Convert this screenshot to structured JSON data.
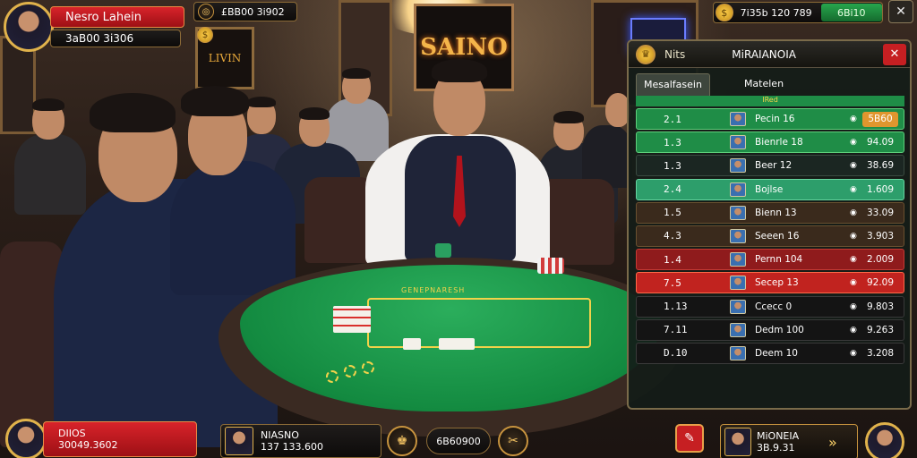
{
  "top_left": {
    "player_name": "Nesro Lahein",
    "player_balance": "3aB00 3i306"
  },
  "top_center": {
    "balance": "£BB00 3i902"
  },
  "top_right": {
    "balance": "7i35b 120 789",
    "amount": "6Bi10",
    "close_glyph": "✕"
  },
  "wall": {
    "sign_text": "SAINO",
    "sign2_text": "LIVIN"
  },
  "panel": {
    "header_left": "Nits",
    "header_title": "MiRAIANOIA",
    "close_glyph": "✕",
    "tabs": [
      {
        "label": "Mesalfasein"
      },
      {
        "label": "Matelen"
      }
    ],
    "subheader": "IRed",
    "rows": [
      {
        "pos": "2.1",
        "name": "Pecin 16",
        "amount": "5B60",
        "theme": "green",
        "amt_bg": "#e0962e"
      },
      {
        "pos": "1.3",
        "name": "Bienrle 18",
        "amount": "94.09",
        "theme": "green",
        "amt_bg": ""
      },
      {
        "pos": "1.3",
        "name": "Beer 12",
        "amount": "38.69",
        "theme": "dark",
        "amt_bg": ""
      },
      {
        "pos": "2.4",
        "name": "Bojlse",
        "amount": "1.609",
        "theme": "teal",
        "amt_bg": ""
      },
      {
        "pos": "1.5",
        "name": "Bienn 13",
        "amount": "33.09",
        "theme": "brown",
        "amt_bg": ""
      },
      {
        "pos": "4.3",
        "name": "Seeen 16",
        "amount": "3.903",
        "theme": "brown",
        "amt_bg": ""
      },
      {
        "pos": "1.4",
        "name": "Pernn 104",
        "amount": "2.009",
        "theme": "red",
        "amt_bg": ""
      },
      {
        "pos": "7.5",
        "name": "Secep 13",
        "amount": "92.09",
        "theme": "redbright",
        "amt_bg": ""
      },
      {
        "pos": "1.13",
        "name": "Ccecc 0",
        "amount": "9.803",
        "theme": "black",
        "amt_bg": ""
      },
      {
        "pos": "7.11",
        "name": "Dedm 100",
        "amount": "9.263",
        "theme": "black",
        "amt_bg": ""
      },
      {
        "pos": "D.10",
        "name": "Deem 10",
        "amount": "3.208",
        "theme": "black",
        "amt_bg": ""
      }
    ]
  },
  "bottom": {
    "left_name": "DIIOS",
    "left_balance": "30049.3602",
    "mid_name": "NIASNO",
    "mid_balance": "137 133.600",
    "pill_value": "6B60900",
    "right_name": "MiONEIA",
    "right_balance": "3B.9.31",
    "chevron": "»"
  },
  "table": {
    "layout_label": "GENEPNARESH"
  },
  "colors": {
    "accent_gold": "#e0b24b",
    "red": "#c51f26",
    "green": "#1c9b4c"
  }
}
